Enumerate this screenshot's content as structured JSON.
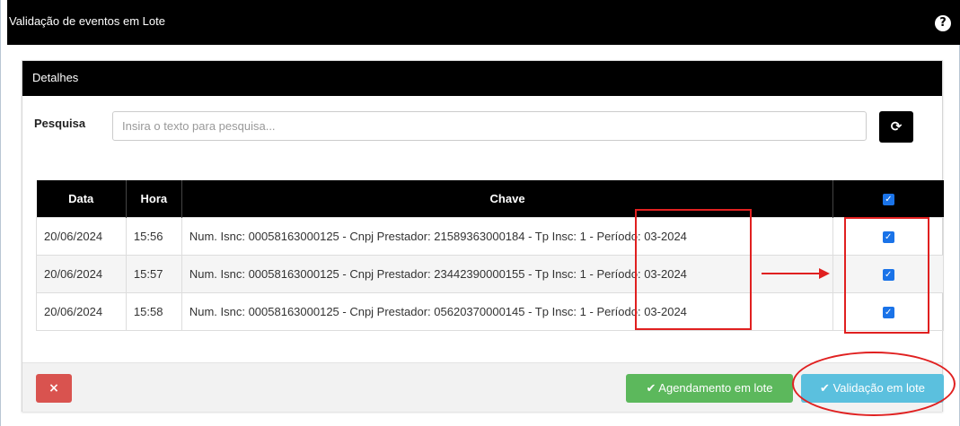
{
  "window": {
    "title": "Validação de eventos em Lote",
    "help_icon": "?"
  },
  "panel": {
    "header": "Detalhes",
    "search": {
      "label": "Pesquisa",
      "placeholder": "Insira o texto para pesquisa...",
      "value": ""
    },
    "refresh_icon": "refresh-icon"
  },
  "table": {
    "headers": {
      "data": "Data",
      "hora": "Hora",
      "chave": "Chave",
      "select_all_checked": true
    },
    "rows": [
      {
        "data": "20/06/2024",
        "hora": "15:56",
        "chave": "Num. Isnc: 00058163000125 - Cnpj Prestador: 21589363000184 - Tp Insc: 1 - Período: 03-2024",
        "checked": true
      },
      {
        "data": "20/06/2024",
        "hora": "15:57",
        "chave": "Num. Isnc: 00058163000125 - Cnpj Prestador: 23442390000155 - Tp Insc: 1 - Período: 03-2024",
        "checked": true
      },
      {
        "data": "20/06/2024",
        "hora": "15:58",
        "chave": "Num. Isnc: 00058163000125 - Cnpj Prestador: 05620370000145 - Tp Insc: 1 - Período: 03-2024",
        "checked": true
      }
    ]
  },
  "footer": {
    "cancel_icon": "×",
    "schedule_label": "Agendamento em lote",
    "validate_label": "Validação em lote"
  },
  "colors": {
    "header_bg": "#000000",
    "cancel": "#d9534f",
    "schedule": "#5cb85c",
    "validate": "#5bc0de",
    "annotation": "#e02020"
  }
}
